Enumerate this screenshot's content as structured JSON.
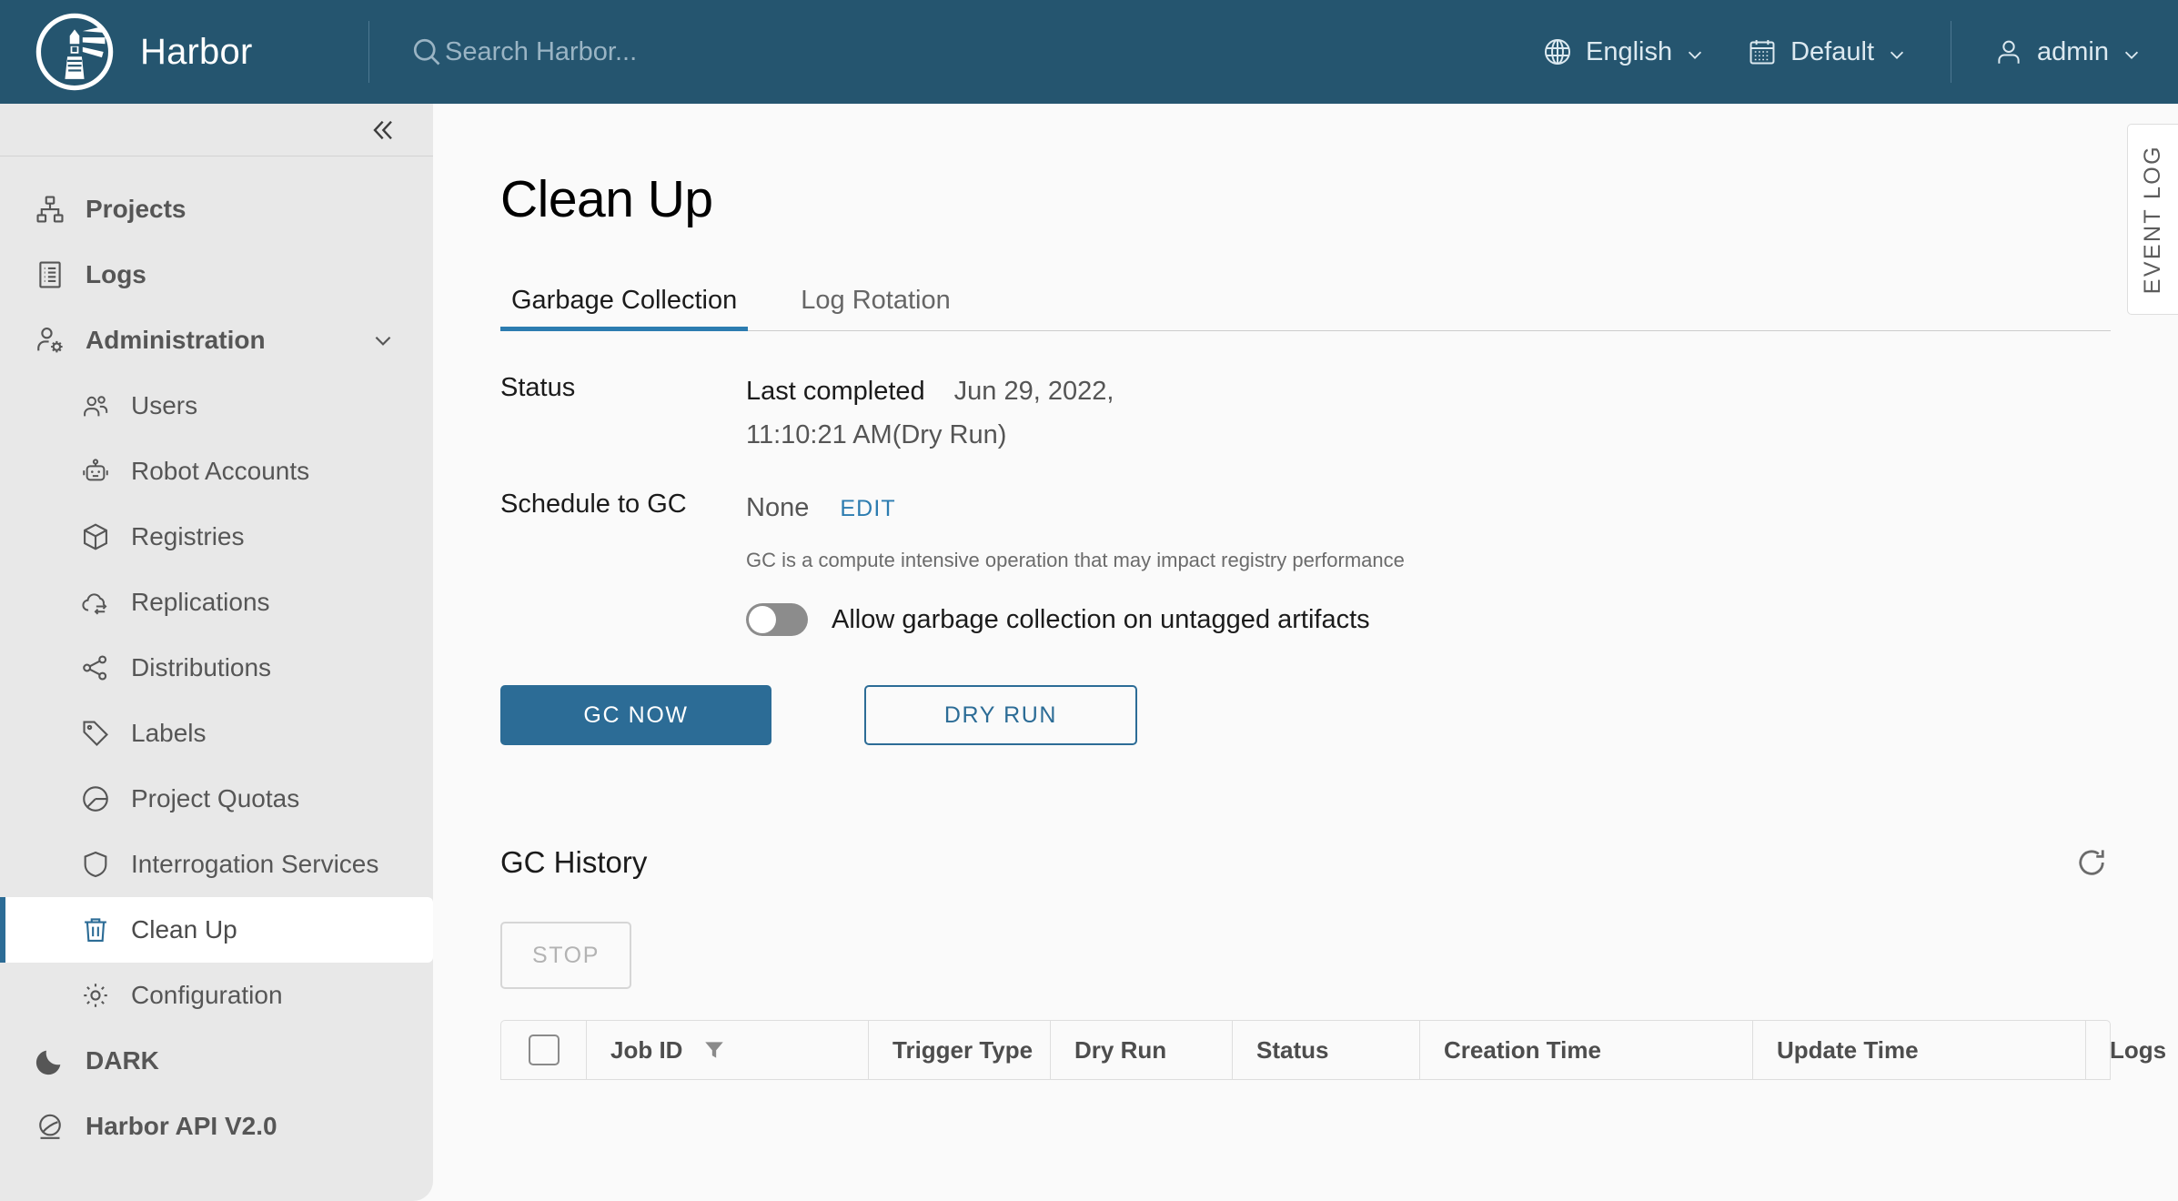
{
  "header": {
    "logo_icon": "harbor-lighthouse-logo",
    "brand_title": "Harbor",
    "search": {
      "icon": "search-icon",
      "placeholder": "Search Harbor...",
      "value": ""
    },
    "language": {
      "icon": "globe-icon",
      "label": "English",
      "caret": "chevron-down-icon"
    },
    "project_scope": {
      "icon": "calendar-icon",
      "label": "Default",
      "caret": "chevron-down-icon"
    },
    "user": {
      "icon": "user-icon",
      "label": "admin",
      "caret": "chevron-down-icon"
    }
  },
  "sidebar": {
    "collapse_icon": "double-chevron-left-icon",
    "items": [
      {
        "label": "Projects",
        "icon": "projects-icon",
        "level": "top",
        "selected": false
      },
      {
        "label": "Logs",
        "icon": "logs-icon",
        "level": "top",
        "selected": false
      },
      {
        "label": "Administration",
        "icon": "administration-icon",
        "level": "top",
        "selected": false,
        "expand": "chevron-down-icon"
      },
      {
        "label": "Users",
        "icon": "users-icon",
        "level": "sub",
        "selected": false
      },
      {
        "label": "Robot Accounts",
        "icon": "robot-icon",
        "level": "sub",
        "selected": false
      },
      {
        "label": "Registries",
        "icon": "cube-icon",
        "level": "sub",
        "selected": false
      },
      {
        "label": "Replications",
        "icon": "cloud-sync-icon",
        "level": "sub",
        "selected": false
      },
      {
        "label": "Distributions",
        "icon": "share-nodes-icon",
        "level": "sub",
        "selected": false
      },
      {
        "label": "Labels",
        "icon": "tag-icon",
        "level": "sub",
        "selected": false
      },
      {
        "label": "Project Quotas",
        "icon": "pie-chart-icon",
        "level": "sub",
        "selected": false
      },
      {
        "label": "Interrogation Services",
        "icon": "shield-icon",
        "level": "sub",
        "selected": false
      },
      {
        "label": "Clean Up",
        "icon": "trash-icon",
        "level": "sub",
        "selected": true
      },
      {
        "label": "Configuration",
        "icon": "gear-icon",
        "level": "sub",
        "selected": false
      },
      {
        "label": "DARK",
        "icon": "moon-icon",
        "level": "top",
        "selected": false
      },
      {
        "label": "Harbor API V2.0",
        "icon": "api-globe-icon",
        "level": "top",
        "selected": false
      }
    ]
  },
  "main": {
    "page_title": "Clean Up",
    "tabs": [
      {
        "label": "Garbage Collection",
        "active": true
      },
      {
        "label": "Log Rotation",
        "active": false
      }
    ],
    "status": {
      "label": "Status",
      "value_prefix": "Last completed",
      "value_date": "Jun 29, 2022,",
      "value_time": "11:10:21 AM(Dry Run)"
    },
    "schedule": {
      "label": "Schedule to GC",
      "value": "None",
      "edit_label": "EDIT"
    },
    "hint": "GC is a compute intensive operation that may impact registry performance",
    "untagged_toggle": {
      "label": "Allow garbage collection on untagged artifacts",
      "checked": false
    },
    "actions": {
      "gc_now_label": "GC NOW",
      "dry_run_label": "DRY RUN"
    },
    "history": {
      "title": "GC History",
      "refresh_icon": "refresh-icon",
      "stop_label": "STOP",
      "stop_disabled": true,
      "columns": [
        "Job ID",
        "Trigger Type",
        "Dry Run",
        "Status",
        "Creation Time",
        "Update Time",
        "Logs"
      ],
      "filter_icon": "funnel-filter-icon",
      "rows": []
    }
  },
  "event_log": {
    "label": "EVENT LOG"
  },
  "colors": {
    "header_bg": "#25556f",
    "accent": "#2c6c96",
    "tab_active": "#2c7cb0",
    "sidebar_bg": "#e8e8e8",
    "page_bg": "#fafafa"
  }
}
